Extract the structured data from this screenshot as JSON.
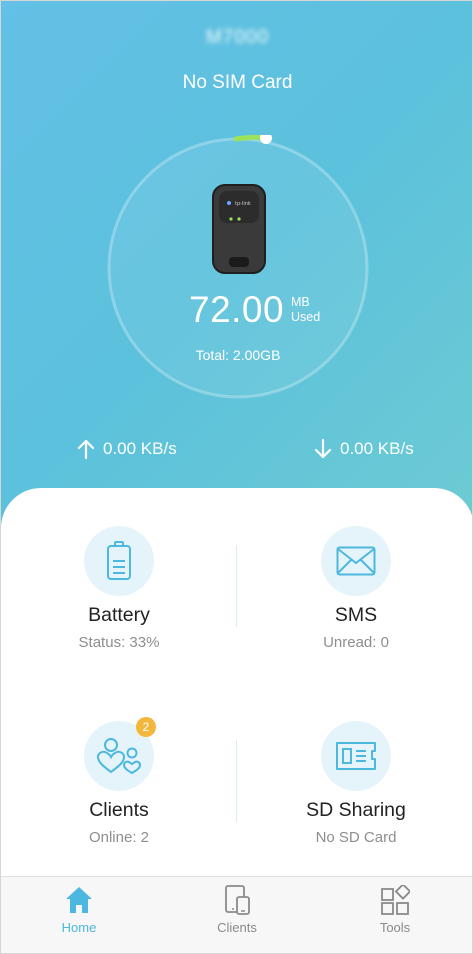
{
  "header": {
    "device_name": "M7000",
    "sim_status": "No SIM Card"
  },
  "usage": {
    "value": "72.00",
    "unit_top": "MB",
    "unit_bottom": "Used",
    "total": "Total: 2.00GB"
  },
  "speed": {
    "upload": "0.00 KB/s",
    "download": "0.00 KB/s"
  },
  "tiles": {
    "battery": {
      "title": "Battery",
      "subtitle": "Status: 33%"
    },
    "sms": {
      "title": "SMS",
      "subtitle": "Unread: 0"
    },
    "clients": {
      "title": "Clients",
      "subtitle": "Online: 2",
      "badge": "2"
    },
    "sd_sharing": {
      "title": "SD Sharing",
      "subtitle": "No SD Card"
    }
  },
  "tabbar": {
    "items": [
      {
        "label": "Home",
        "icon": "home-icon",
        "active": true
      },
      {
        "label": "Clients",
        "icon": "devices-icon",
        "active": false
      },
      {
        "label": "Tools",
        "icon": "tools-icon",
        "active": false
      }
    ]
  },
  "colors": {
    "accent": "#4cb8df",
    "usage_arc": "#9de35a",
    "badge": "#f3b73d",
    "hero_start": "#63c0e6",
    "hero_end": "#6dcbd2"
  }
}
